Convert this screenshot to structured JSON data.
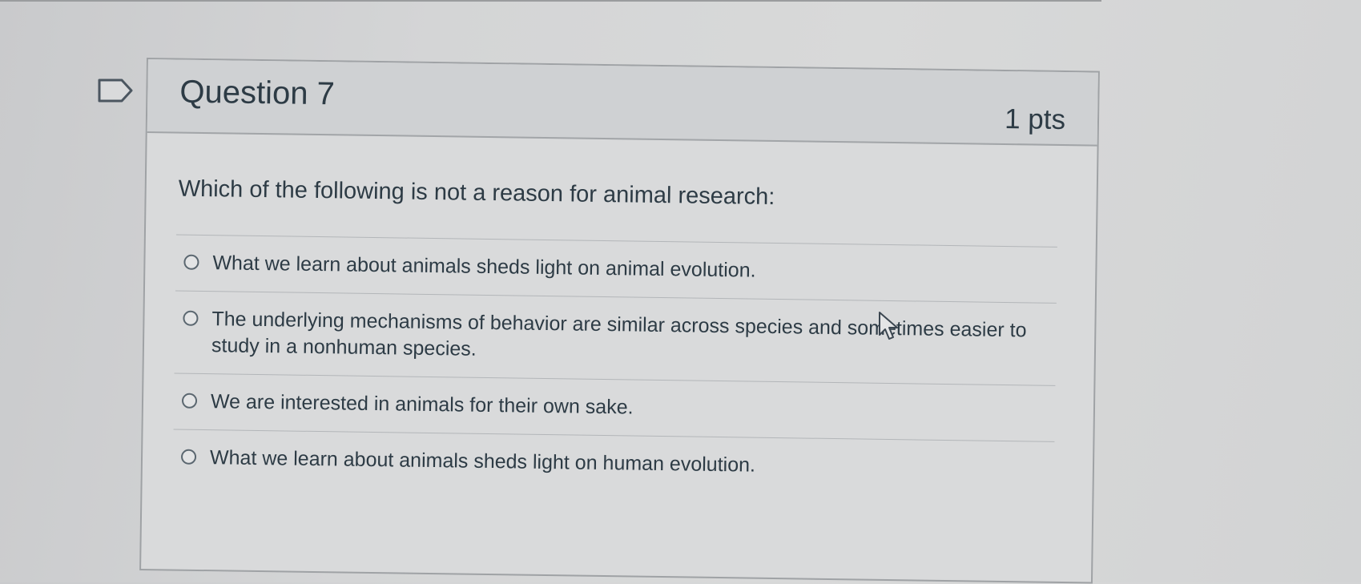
{
  "question": {
    "title": "Question 7",
    "points": "1 pts",
    "text": "Which of the following is not a reason for animal research:",
    "answers": [
      {
        "label": "What we learn about animals sheds light on animal evolution."
      },
      {
        "label": "The underlying mechanisms of behavior are similar across species and sometimes easier to study in a nonhuman species."
      },
      {
        "label": "We are interested in animals for their own sake."
      },
      {
        "label": "What we learn about animals sheds light on human evolution."
      }
    ]
  },
  "icons": {
    "flag": "flag-question-icon",
    "cursor": "mouse-pointer-icon",
    "radio": "radio-button-icon"
  },
  "colors": {
    "text": "#2d3b45",
    "border": "#9fa2a5",
    "header_bg": "#cfd1d3"
  }
}
